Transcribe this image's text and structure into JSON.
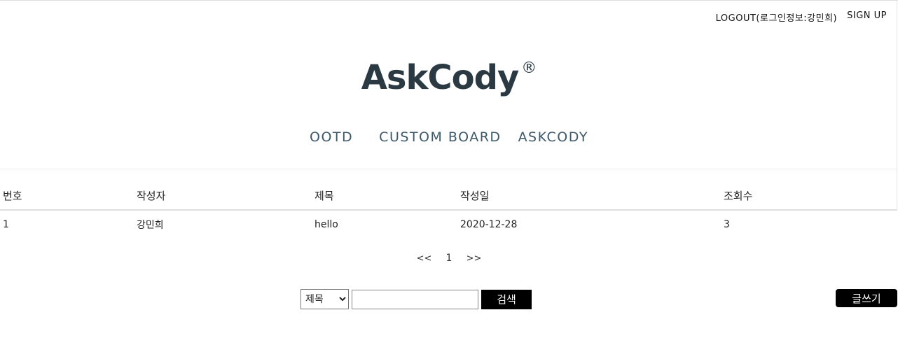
{
  "header": {
    "logout_link": "LOGOUT(로그인정보:강민희)",
    "signup_link": "SIGN UP",
    "logo_text": "AskCody",
    "logo_mark": "®"
  },
  "nav": {
    "items": [
      {
        "label": "OOTD"
      },
      {
        "label": "CUSTOM BOARD"
      },
      {
        "label": "ASKCODY"
      }
    ]
  },
  "board": {
    "columns": [
      "번호",
      "작성자",
      "제목",
      "작성일",
      "조회수"
    ],
    "rows": [
      {
        "num": "1",
        "writer": "강민희",
        "title": "hello",
        "date": "2020-12-28",
        "views": "3"
      }
    ]
  },
  "pagination": {
    "prev": "<<",
    "current": "1",
    "next": ">>"
  },
  "search": {
    "field_selected": "제목",
    "field_options": [
      "제목"
    ],
    "query_value": "",
    "button_label": "검색"
  },
  "write_button_label": "글쓰기"
}
